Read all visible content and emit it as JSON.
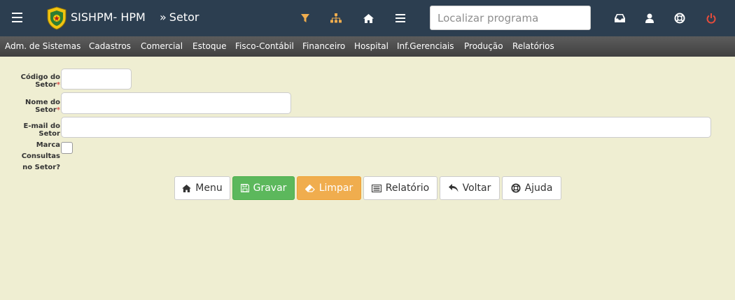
{
  "header": {
    "app_title": "SISHPM- HPM",
    "breadcrumb_prefix": "»",
    "breadcrumb": "Setor",
    "search_placeholder": "Localizar programa"
  },
  "menu": [
    "Adm. de Sistemas",
    "Cadastros",
    "Comercial",
    "Estoque",
    "Fisco-Contábil",
    "Financeiro",
    "Hospital",
    "Inf.Gerenciais",
    "Produção",
    "Relatórios"
  ],
  "form": {
    "codigo_label": "Código do Setor",
    "nome_label": "Nome do Setor",
    "email_label": "E-mail do Setor",
    "marca_label_line1": "Marca Consultas",
    "marca_label_line2": "no Setor?",
    "required_mark": "*",
    "codigo_value": "",
    "nome_value": "",
    "email_value": "",
    "marca_checked": false
  },
  "buttons": {
    "menu": "Menu",
    "gravar": "Gravar",
    "limpar": "Limpar",
    "relatorio": "Relatório",
    "voltar": "Voltar",
    "ajuda": "Ajuda"
  },
  "icons": {
    "hamburger": "hamburger-menu-icon",
    "logo": "police-crest-logo",
    "filter": "filter-icon",
    "sitemap": "sitemap-icon",
    "home": "home-icon",
    "list": "list-icon",
    "inbox": "inbox-icon",
    "user": "user-icon",
    "help": "life-ring-icon",
    "power": "power-icon"
  },
  "colors": {
    "topbar": "#2c3e50",
    "menubar": "#4a4a4a",
    "background": "#efeed2",
    "accent_filter": "#f0ad4e",
    "power": "#e74c3c",
    "success": "#5cb85c",
    "warning": "#f0ad4e",
    "required": "#d9534f"
  }
}
